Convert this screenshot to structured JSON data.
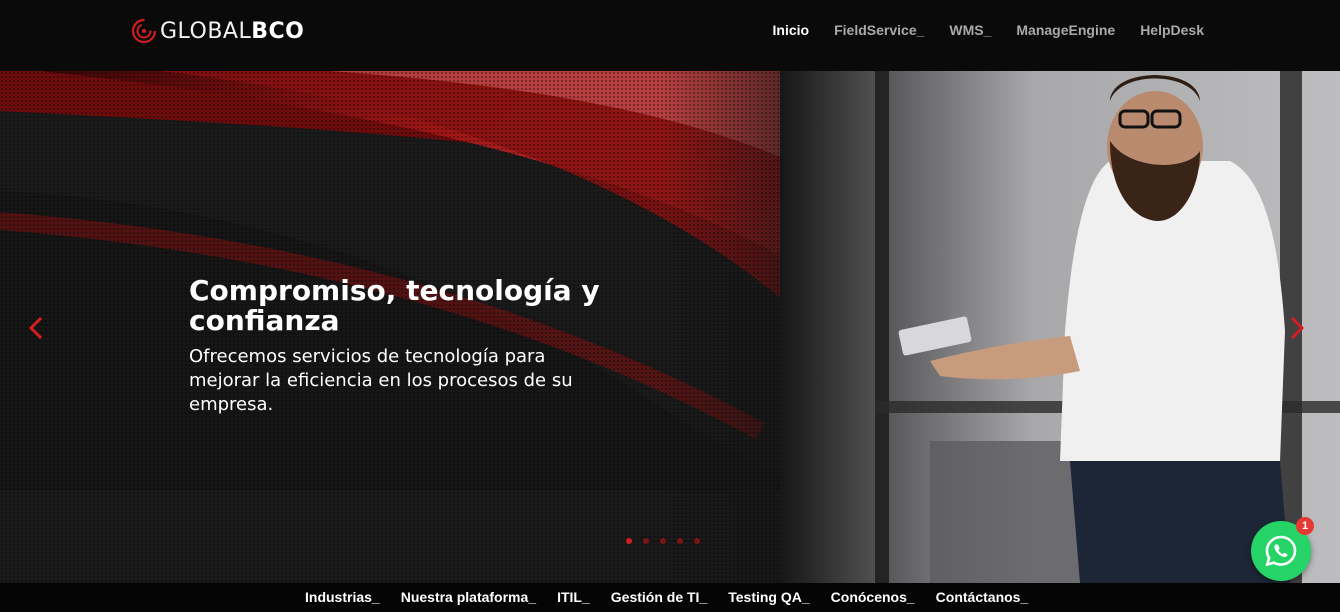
{
  "brand": {
    "logo_light": "GLOBAL",
    "logo_bold": "BCO",
    "accent": "#d21e1e"
  },
  "nav": {
    "items": [
      {
        "label": "Inicio",
        "active": true
      },
      {
        "label": "FieldService_"
      },
      {
        "label": "WMS_"
      },
      {
        "label": "ManageEngine"
      },
      {
        "label": "HelpDesk"
      }
    ]
  },
  "hero": {
    "title": "Compromiso, tecnología y confianza",
    "subtitle": "Ofrecemos servicios de tecnología para mejorar la eficiencia en los procesos de su empresa.",
    "prev_icon": "chevron-left-icon",
    "next_icon": "chevron-right-icon",
    "slide_count": 5,
    "active_slide": 1
  },
  "bottom_nav": {
    "items": [
      {
        "label": "Industrias_"
      },
      {
        "label": "Nuestra plataforma_"
      },
      {
        "label": "ITIL_"
      },
      {
        "label": "Gestión de TI_"
      },
      {
        "label": "Testing QA_"
      },
      {
        "label": "Conócenos_"
      },
      {
        "label": "Contáctanos_"
      }
    ]
  },
  "whatsapp": {
    "icon": "whatsapp-icon",
    "badge_count": "1",
    "color": "#25d366"
  }
}
